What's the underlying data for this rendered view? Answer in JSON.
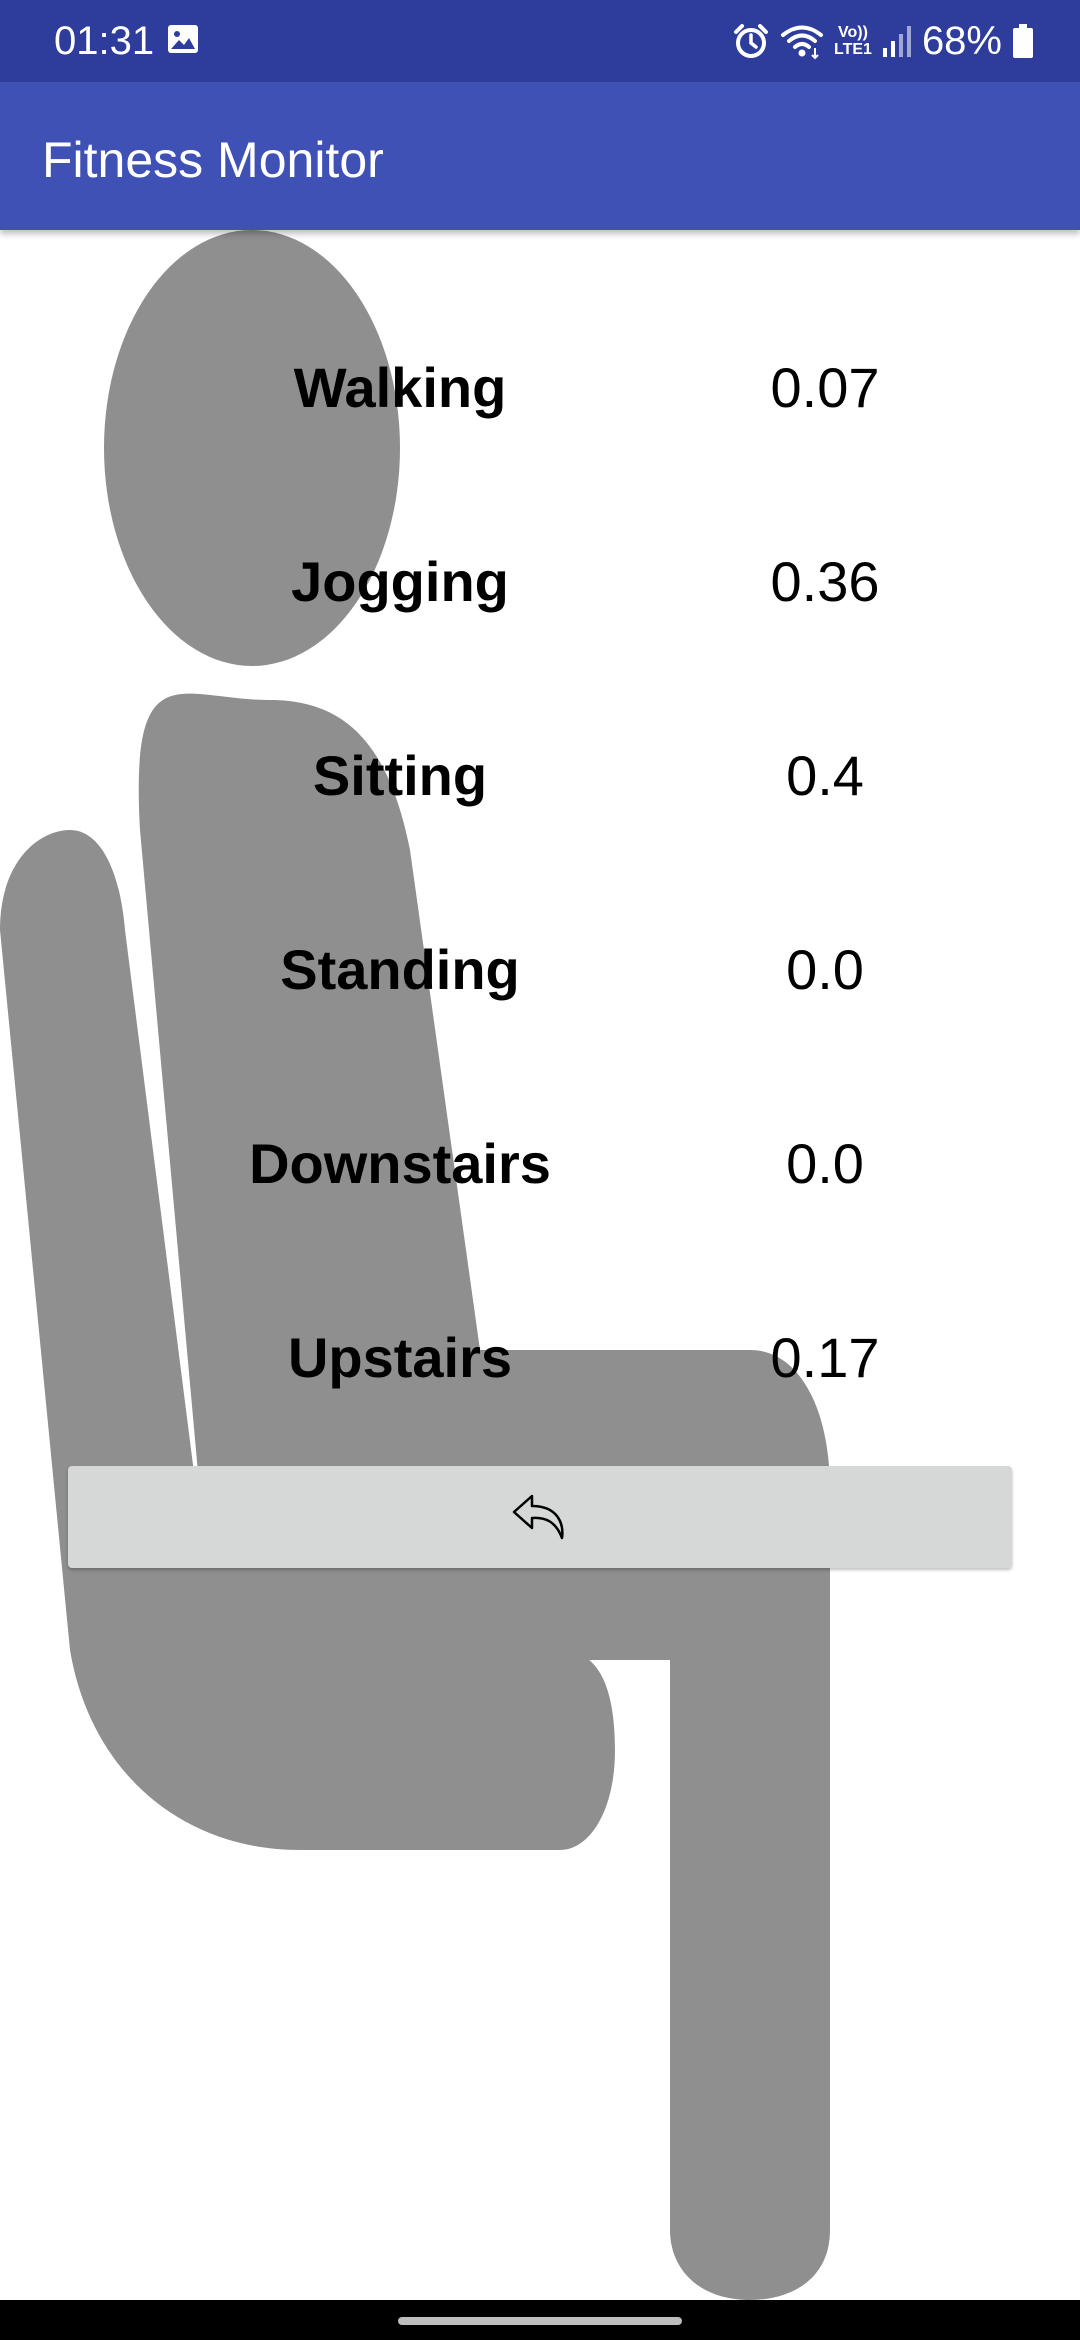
{
  "status_bar": {
    "time": "01:31",
    "battery_percent": "68%",
    "network_label_top": "Vo))",
    "network_label_bottom": "LTE1",
    "icons": [
      "gallery-icon",
      "alarm-icon",
      "wifi-icon",
      "volte-icon",
      "signal-icon",
      "battery-icon"
    ],
    "background_color": "#2e3d9b"
  },
  "app_bar": {
    "title": "Fitness Monitor",
    "background_color": "#3f51b5"
  },
  "activities": [
    {
      "label": "Walking",
      "value": "0.07"
    },
    {
      "label": "Jogging",
      "value": "0.36"
    },
    {
      "label": "Sitting",
      "value": "0.4"
    },
    {
      "label": "Standing",
      "value": "0.0"
    },
    {
      "label": "Downstairs",
      "value": "0.0"
    },
    {
      "label": "Upstairs",
      "value": "0.17"
    }
  ],
  "background_image": {
    "icon": "sitting-person-icon",
    "color": "#8f8f8f"
  },
  "back_button": {
    "icon": "undo-arrow-icon",
    "background_color": "#d6d7d7"
  }
}
